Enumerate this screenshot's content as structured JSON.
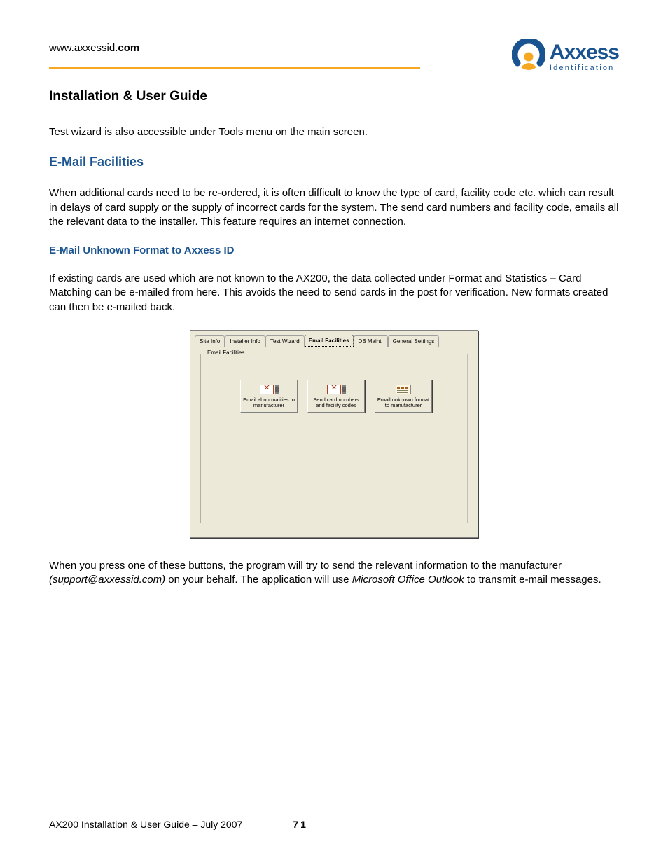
{
  "header": {
    "url_prefix": "www.axxessid.",
    "url_bold": "com",
    "logo": {
      "name": "Axxess",
      "tagline": "Identification"
    }
  },
  "doc_title": "Installation & User Guide",
  "para_intro": "Test wizard is also accessible under Tools menu on the main screen.",
  "section_email_facilities": "E-Mail Facilities",
  "para_email_facilities": "When additional cards need to be re-ordered, it is often difficult to know the type of card, facility code etc. which can result in delays of card supply or the supply of incorrect cards for the system. The send card numbers and facility code, emails all the relevant data to the installer. This feature requires an internet connection.",
  "subsection_unknown": "E-Mail Unknown Format to Axxess ID",
  "para_unknown": "If existing cards are used which are not known to the AX200, the data collected under Format and Statistics – Card Matching can be e-mailed from here.  This avoids the need to send cards in the post for verification.  New formats created can then be e-mailed back.",
  "dialog": {
    "tabs": [
      "Site Info",
      "Installer Info",
      "Test Wizard",
      "Email Facilities",
      "DB Maint.",
      "General Settings"
    ],
    "active_tab_index": 3,
    "group_legend": "Email Facilities",
    "buttons": [
      {
        "label": "Email abnormalities to manufacturer",
        "icon": "mail"
      },
      {
        "label": "Send card numbers and facility codes",
        "icon": "mail"
      },
      {
        "label": "Email unknown format to manufacturer",
        "icon": "card"
      }
    ]
  },
  "para_press_pre": "When you press one of these buttons, the program will try to send the relevant information to the manufacturer ",
  "para_press_em1": "(support@axxessid.com)",
  "para_press_mid": " on your behalf. The application will use ",
  "para_press_em2": "Microsoft Office Outlook",
  "para_press_post": " to transmit e-mail messages.",
  "footer": {
    "text": "AX200 Installation & User Guide – July 2007",
    "page": "71"
  }
}
